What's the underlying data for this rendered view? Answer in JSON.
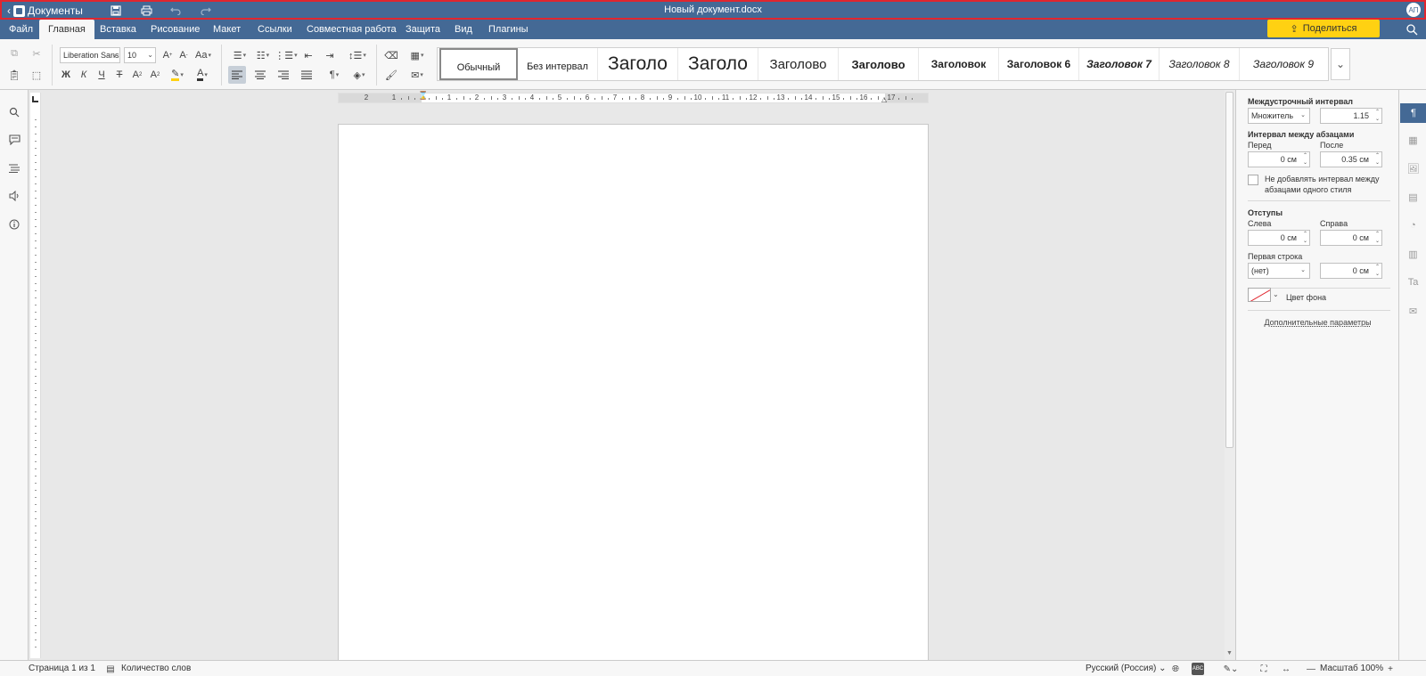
{
  "titlebar": {
    "back_label": "Документы",
    "doc_title": "Новый документ.docx",
    "avatar_initials": "АП"
  },
  "menu": {
    "tabs": [
      "Файл",
      "Главная",
      "Вставка",
      "Рисование",
      "Макет",
      "Ссылки",
      "Совместная работа",
      "Защита",
      "Вид",
      "Плагины"
    ],
    "active_tab": "Главная",
    "share_label": "Поделиться"
  },
  "toolbar": {
    "font_name": "Liberation Sans",
    "font_size": "10",
    "styles": [
      "Обычный",
      "Без интервал",
      "Заголо",
      "Заголо",
      "Заголово",
      "Заголово",
      "Заголовок",
      "Заголовок 6",
      "Заголовок 7",
      "Заголовок 8",
      "Заголовок 9"
    ]
  },
  "ruler": {
    "numbers": [
      "2",
      "1",
      "1",
      "2",
      "3",
      "4",
      "5",
      "6",
      "7",
      "8",
      "9",
      "10",
      "11",
      "12",
      "13",
      "14",
      "15",
      "16",
      "17"
    ]
  },
  "panel": {
    "line_spacing_title": "Междустрочный интервал",
    "line_spacing_mode": "Множитель",
    "line_spacing_value": "1.15",
    "paragraph_spacing_title": "Интервал между абзацами",
    "before_label": "Перед",
    "after_label": "После",
    "before_value": "0 см",
    "after_value": "0.35 см",
    "no_add_interval_label": "Не добавлять интервал между абзацами одного стиля",
    "indents_title": "Отступы",
    "left_label": "Слева",
    "right_label": "Справа",
    "left_value": "0 см",
    "right_value": "0 см",
    "first_line_label": "Первая строка",
    "first_line_mode": "(нет)",
    "first_line_value": "0 см",
    "bg_color_label": "Цвет фона",
    "advanced_link": "Дополнительные параметры"
  },
  "status": {
    "page_info": "Страница 1 из 1",
    "word_count": "Количество слов",
    "language": "Русский (Россия)",
    "zoom": "Масштаб 100%"
  },
  "colors": {
    "header_blue": "#446995",
    "highlight_red": "#e0262f",
    "share_yellow": "#ffd112"
  }
}
